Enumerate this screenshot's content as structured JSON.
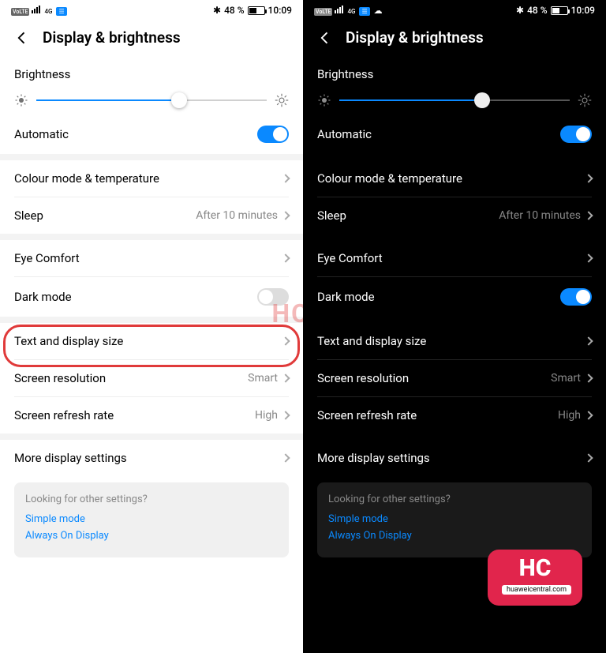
{
  "status": {
    "time": "10:09",
    "battery": "48 %",
    "netLabel": "4G"
  },
  "header": {
    "title": "Display & brightness"
  },
  "brightness": {
    "label": "Brightness",
    "fillPercent": 62
  },
  "auto": {
    "label": "Automatic"
  },
  "group1": {
    "colour": {
      "label": "Colour mode & temperature"
    },
    "sleep": {
      "label": "Sleep",
      "value": "After 10 minutes"
    }
  },
  "group2": {
    "eye": {
      "label": "Eye Comfort"
    },
    "dark": {
      "label": "Dark mode"
    }
  },
  "group3": {
    "text": {
      "label": "Text and display size"
    },
    "res": {
      "label": "Screen resolution",
      "value": "Smart"
    },
    "refresh": {
      "label": "Screen refresh rate",
      "value": "High"
    }
  },
  "more": {
    "label": "More display settings"
  },
  "card": {
    "title": "Looking for other settings?",
    "link1": "Simple mode",
    "link2": "Always On Display"
  },
  "watermark": {
    "text": "HC",
    "url": "huaweicentral.com"
  }
}
